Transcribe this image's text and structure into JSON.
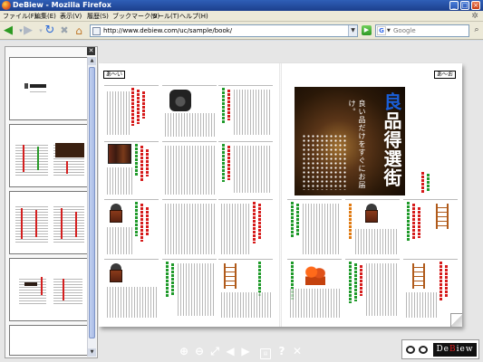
{
  "window": {
    "title": "DeBiew - Mozilla Firefox",
    "controls": [
      "_",
      "□",
      "×"
    ]
  },
  "menu": {
    "items": [
      "ファイル(F)",
      "編集(E)",
      "表示(V)",
      "履歴(S)",
      "ブックマーク(B)",
      "ツール(T)",
      "ヘルプ(H)"
    ]
  },
  "nav": {
    "url": "http://www.debiew.com/uc/sample/book/",
    "search_placeholder": "Google",
    "search_engine_icon": "G"
  },
  "book": {
    "left_page_tag": "あ～い",
    "right_page_tag": "あ～お",
    "cover": {
      "title_accent": "良",
      "title_rest": "品得選街",
      "subtitle": "良い品だけをすぐにお届け。"
    }
  },
  "toolbar": {
    "buttons": [
      "zoom-in",
      "zoom-out",
      "fit",
      "prev-page",
      "next-page",
      "doc-info",
      "help",
      "close"
    ],
    "help_label": "?",
    "close_label": "✕"
  },
  "logo": {
    "text": "DeBiew",
    "accent_letter": "B"
  },
  "colors": {
    "titlebar": "#2f5fb8",
    "accent_red": "#d61b1b",
    "accent_green": "#1f9a2a",
    "cover_title_blue": "#1a5fd8"
  }
}
